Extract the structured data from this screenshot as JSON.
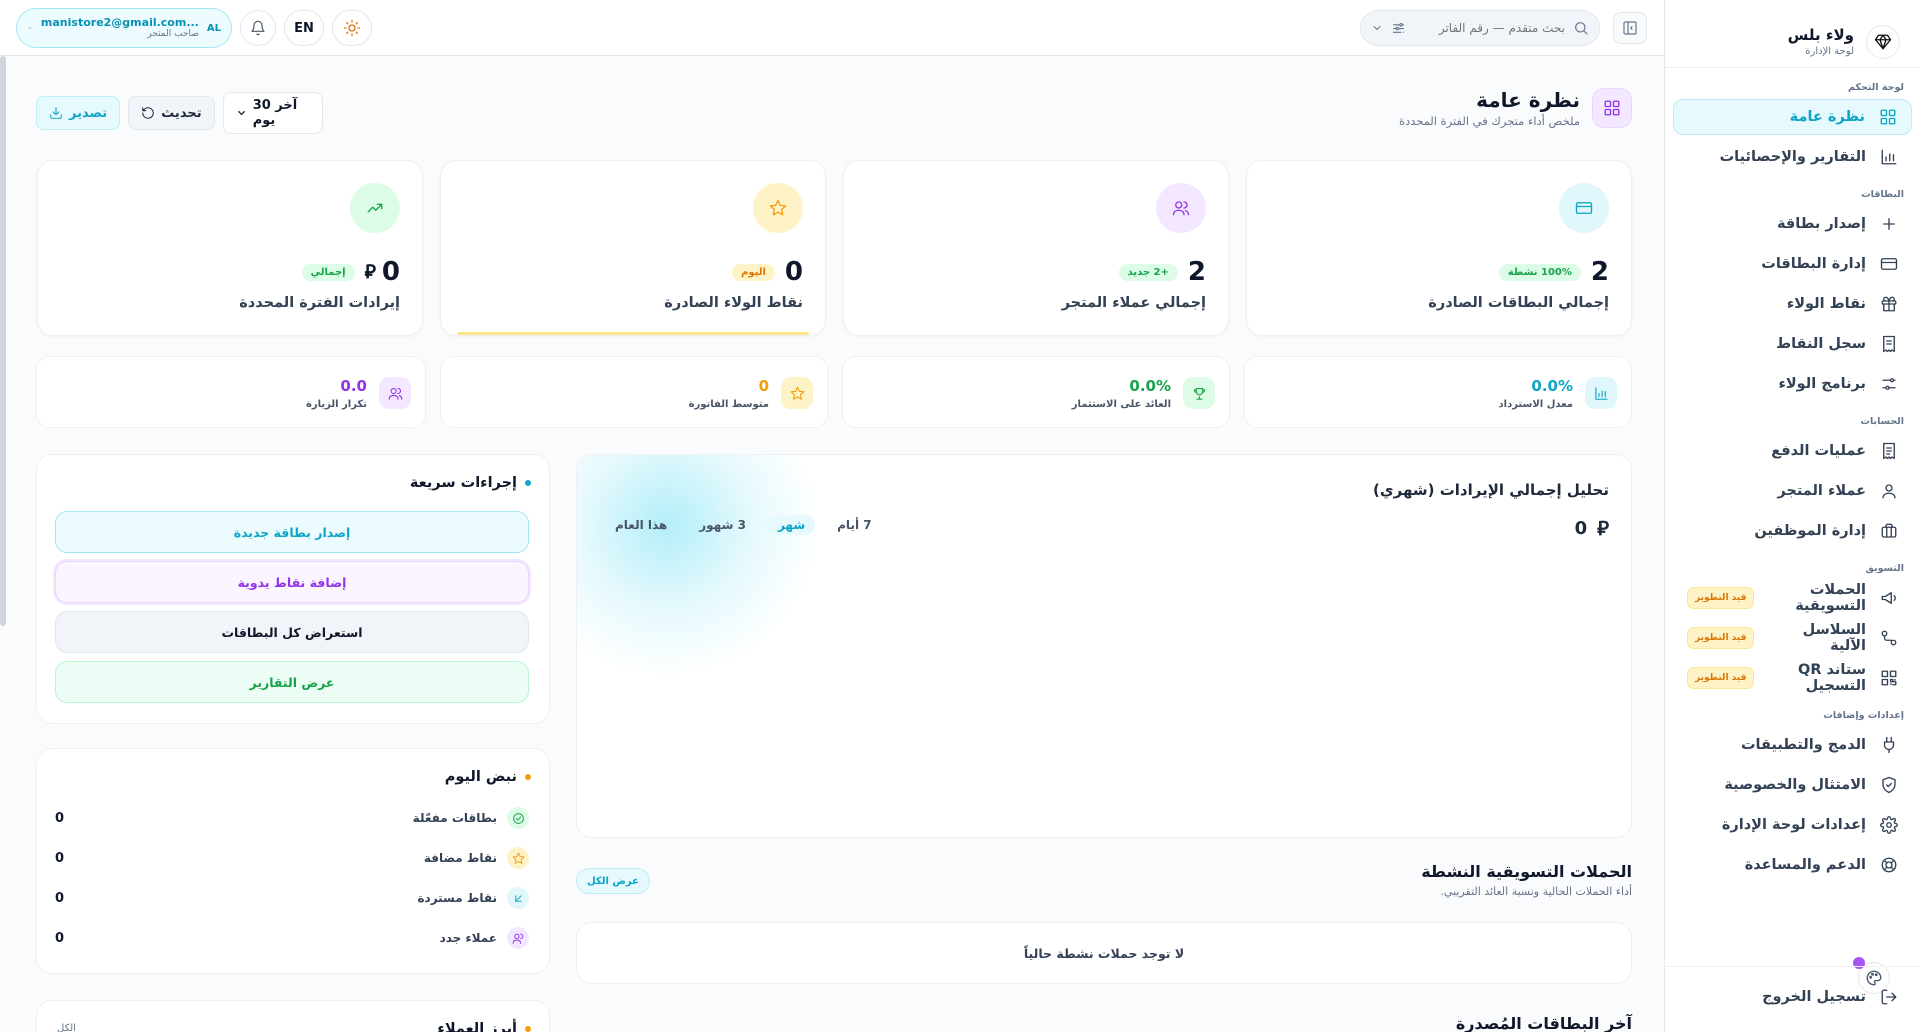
{
  "sidebar": {
    "brand_title": "ولاء بلس",
    "brand_subtitle": "لوحة الإدارة",
    "sections": {
      "dashboard": "لوحة التحكم",
      "cards": "البطاقات",
      "accounts": "الحسابات",
      "marketing": "التسويق",
      "settings": "إعدادات وإضافات"
    },
    "items": {
      "overview": "نظرة عامة",
      "reports": "التقارير والإحصائيات",
      "issue_card": "إصدار بطاقة",
      "manage_cards": "إدارة البطاقات",
      "loyalty_points": "نقاط الولاء",
      "points_log": "سجل النقاط",
      "loyalty_program": "برنامج الولاء",
      "payments": "عمليات الدفع",
      "customers": "عملاء المتجر",
      "staff": "إدارة الموظفين",
      "campaigns": "الحملات التسويقية",
      "automation": "السلاسل الآلية",
      "qr_stand": "ستاند QR التسجيل",
      "integrations": "الدمج والتطبيقات",
      "compliance": "الامتثال والخصوصية",
      "admin_settings": "إعدادات لوحة الإدارة",
      "support": "الدعم والمساعدة",
      "logout": "تسجيل الخروج"
    },
    "dev_badge": "قيد التطوير"
  },
  "topbar": {
    "account_email": "manistore2@gmail.com...",
    "account_role": "صاحب المتجر",
    "account_initials": "AL",
    "language": "EN",
    "search_placeholder": "بحث متقدم — رقم الفاتر"
  },
  "header": {
    "title": "نظرة عامة",
    "subtitle": "ملخص أداء متجرك في الفترة المحددة",
    "range_label": "آخر 30 يوم",
    "refresh_label": "تحديث",
    "export_label": "تصدير"
  },
  "stats": [
    {
      "value": "2",
      "badge": "100% نشطة",
      "label": "إجمالي البطاقات الصادرة"
    },
    {
      "value": "2",
      "badge": "+2 جديد",
      "label": "إجمالي عملاء المتجر"
    },
    {
      "value": "0",
      "badge": "اليوم",
      "label": "نقاط الولاء الصادرة"
    },
    {
      "value": "0",
      "badge": "إجمالي",
      "label": "إيرادات الفترة المحددة"
    }
  ],
  "mini_stats": [
    {
      "value": "0.0%",
      "label": "معدل الاسترداد"
    },
    {
      "value": "0.0%",
      "label": "العائد على الاستثمار"
    },
    {
      "value": "0",
      "label": "متوسط الفاتورة"
    },
    {
      "value": "0.0",
      "label": "تكرار الزيارة"
    }
  ],
  "revenue_chart": {
    "title": "تحليل إجمالي الإيرادات (شهري)",
    "value": "0",
    "tabs": [
      "7 أيام",
      "شهر",
      "3 شهور",
      "هذا العام"
    ],
    "active_tab": "شهر"
  },
  "quick_actions": {
    "title": "إجراءات سريعة",
    "buttons": [
      "إصدار بطاقة جديدة",
      "إضافة نقاط يدوية",
      "استعراض كل البطاقات",
      "عرض التقارير"
    ]
  },
  "pulse": {
    "title": "نبض اليوم",
    "rows": [
      {
        "label": "بطاقات مفعّلة",
        "value": "0"
      },
      {
        "label": "نقاط مضافة",
        "value": "0"
      },
      {
        "label": "نقاط مستردة",
        "value": "0"
      },
      {
        "label": "عملاء جدد",
        "value": "0"
      }
    ]
  },
  "campaigns": {
    "title": "الحملات التسويقية النشطة",
    "subtitle": "أداء الحملات الحالية ونسبة العائد التقريبي.",
    "view_all": "عرض الكل",
    "empty": "لا توجد حملات نشطة حالياً"
  },
  "last_cards_title": "آخر البطاقات المُصدرة",
  "top_customers_title": "أبرز العملاء",
  "top_customers_link": "الكل",
  "colors": {
    "accent": "#0ea5c6",
    "purple": "#9333ea",
    "amber": "#f59e0b",
    "green": "#16a34a"
  }
}
